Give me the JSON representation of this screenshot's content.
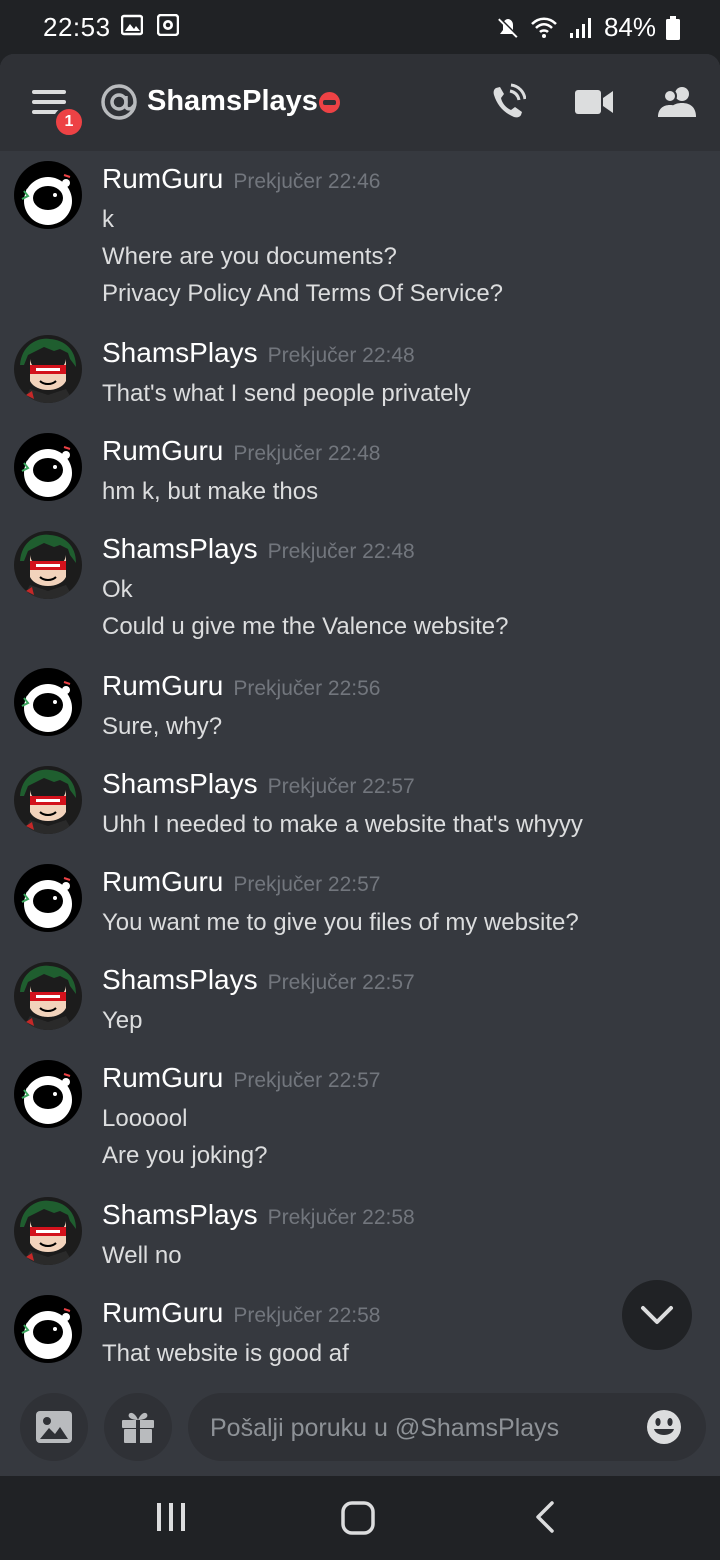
{
  "status_bar": {
    "time": "22:53",
    "battery": "84%",
    "icons": [
      "image-icon",
      "screen-record-icon",
      "mute-icon",
      "wifi-icon",
      "signal-icon",
      "battery-icon"
    ]
  },
  "header": {
    "badge_count": "1",
    "title": "ShamsPlays",
    "status": "do-not-disturb",
    "icons": [
      "menu-icon",
      "at-icon",
      "phone-call-icon",
      "video-call-icon",
      "members-icon"
    ]
  },
  "messages": [
    {
      "author": "RumGuru",
      "time": "Prekjučer 22:46",
      "avatar": "astronaut",
      "lines": [
        "k",
        "Where are you documents?",
        "Privacy Policy And Terms Of Service?"
      ]
    },
    {
      "author": "ShamsPlays",
      "time": "Prekjučer 22:48",
      "avatar": "anime",
      "lines": [
        "That's what I send people privately"
      ]
    },
    {
      "author": "RumGuru",
      "time": "Prekjučer 22:48",
      "avatar": "astronaut",
      "lines": [
        "hm k, but make thos"
      ]
    },
    {
      "author": "ShamsPlays",
      "time": "Prekjučer 22:48",
      "avatar": "anime",
      "lines": [
        "Ok",
        "Could u give me the Valence website?"
      ]
    },
    {
      "author": "RumGuru",
      "time": "Prekjučer 22:56",
      "avatar": "astronaut",
      "lines": [
        "Sure, why?"
      ]
    },
    {
      "author": "ShamsPlays",
      "time": "Prekjučer 22:57",
      "avatar": "anime",
      "lines": [
        "Uhh I needed to make a website that's whyyy"
      ]
    },
    {
      "author": "RumGuru",
      "time": "Prekjučer 22:57",
      "avatar": "astronaut",
      "lines": [
        "You want me to give you files of my website?"
      ]
    },
    {
      "author": "ShamsPlays",
      "time": "Prekjučer 22:57",
      "avatar": "anime",
      "lines": [
        "Yep"
      ]
    },
    {
      "author": "RumGuru",
      "time": "Prekjučer 22:57",
      "avatar": "astronaut",
      "lines": [
        "Loooool",
        "Are you joking?"
      ]
    },
    {
      "author": "ShamsPlays",
      "time": "Prekjučer 22:58",
      "avatar": "anime",
      "lines": [
        "Well no"
      ]
    },
    {
      "author": "RumGuru",
      "time": "Prekjučer 22:58",
      "avatar": "astronaut",
      "lines": [
        "That website is good af"
      ]
    }
  ],
  "composer": {
    "placeholder": "Pošalji poruku u @ShamsPlays",
    "icons": [
      "image-upload-icon",
      "gift-icon",
      "emoji-icon"
    ]
  },
  "colors": {
    "background": "#36393f",
    "header": "#2f3136",
    "statusbar": "#202225",
    "badge": "#ed4245",
    "dnd": "#ed4245",
    "timestamp": "#72767d"
  }
}
